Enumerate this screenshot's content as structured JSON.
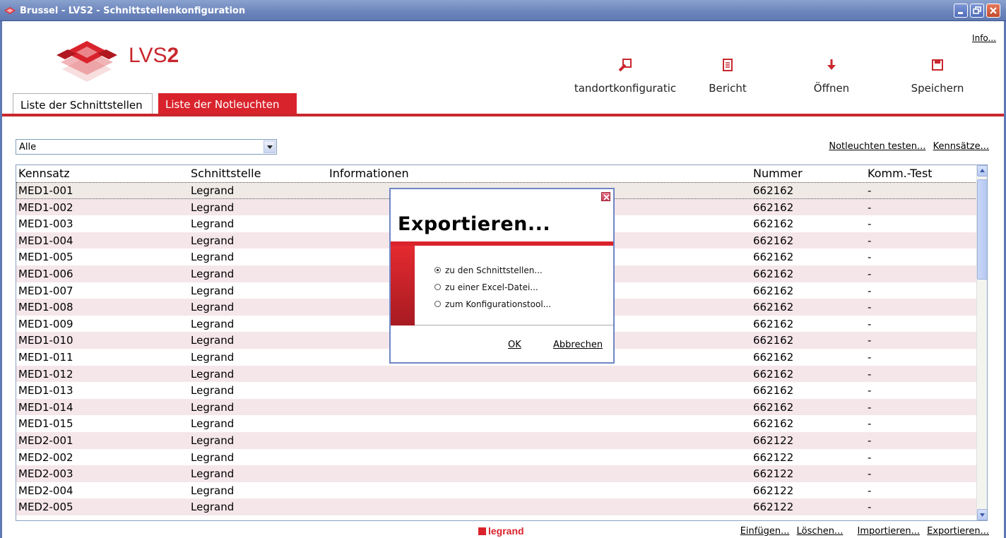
{
  "window": {
    "title": "Brussel   -   LVS2 - Schnittstellenkonfiguration"
  },
  "header": {
    "brand_prefix": "LVS",
    "brand_suffix": "2",
    "info_link": "Info...",
    "tabs": [
      {
        "label": "Liste der Schnittstellen",
        "active": true
      },
      {
        "label": "Liste der Notleuchten",
        "active": false
      }
    ],
    "toolbar": [
      {
        "label": "tandortkonfiguratic",
        "icon": "location-config-icon"
      },
      {
        "label": "Bericht",
        "icon": "report-icon"
      },
      {
        "label": "Öffnen",
        "icon": "open-arrow-icon"
      },
      {
        "label": "Speichern",
        "icon": "save-icon"
      }
    ]
  },
  "filter": {
    "selected": "Alle",
    "links": [
      "Notleuchten testen...",
      "Kennsätze..."
    ]
  },
  "table": {
    "columns": [
      "Kennsatz",
      "Schnittstelle",
      "Informationen",
      "Nummer",
      "Komm.-Test"
    ],
    "rows": [
      {
        "kennsatz": "MED1-001",
        "schnittstelle": "Legrand",
        "info": "",
        "nummer": "662162",
        "test": "-"
      },
      {
        "kennsatz": "MED1-002",
        "schnittstelle": "Legrand",
        "info": "",
        "nummer": "662162",
        "test": "-"
      },
      {
        "kennsatz": "MED1-003",
        "schnittstelle": "Legrand",
        "info": "",
        "nummer": "662162",
        "test": "-"
      },
      {
        "kennsatz": "MED1-004",
        "schnittstelle": "Legrand",
        "info": "",
        "nummer": "662162",
        "test": "-"
      },
      {
        "kennsatz": "MED1-005",
        "schnittstelle": "Legrand",
        "info": "",
        "nummer": "662162",
        "test": "-"
      },
      {
        "kennsatz": "MED1-006",
        "schnittstelle": "Legrand",
        "info": "",
        "nummer": "662162",
        "test": "-"
      },
      {
        "kennsatz": "MED1-007",
        "schnittstelle": "Legrand",
        "info": "",
        "nummer": "662162",
        "test": "-"
      },
      {
        "kennsatz": "MED1-008",
        "schnittstelle": "Legrand",
        "info": "",
        "nummer": "662162",
        "test": "-"
      },
      {
        "kennsatz": "MED1-009",
        "schnittstelle": "Legrand",
        "info": "",
        "nummer": "662162",
        "test": "-"
      },
      {
        "kennsatz": "MED1-010",
        "schnittstelle": "Legrand",
        "info": "",
        "nummer": "662162",
        "test": "-"
      },
      {
        "kennsatz": "MED1-011",
        "schnittstelle": "Legrand",
        "info": "",
        "nummer": "662162",
        "test": "-"
      },
      {
        "kennsatz": "MED1-012",
        "schnittstelle": "Legrand",
        "info": "",
        "nummer": "662162",
        "test": "-"
      },
      {
        "kennsatz": "MED1-013",
        "schnittstelle": "Legrand",
        "info": "",
        "nummer": "662162",
        "test": "-"
      },
      {
        "kennsatz": "MED1-014",
        "schnittstelle": "Legrand",
        "info": "",
        "nummer": "662162",
        "test": "-"
      },
      {
        "kennsatz": "MED1-015",
        "schnittstelle": "Legrand",
        "info": "",
        "nummer": "662162",
        "test": "-"
      },
      {
        "kennsatz": "MED2-001",
        "schnittstelle": "Legrand",
        "info": "",
        "nummer": "662122",
        "test": "-"
      },
      {
        "kennsatz": "MED2-002",
        "schnittstelle": "Legrand",
        "info": "",
        "nummer": "662122",
        "test": "-"
      },
      {
        "kennsatz": "MED2-003",
        "schnittstelle": "Legrand",
        "info": "",
        "nummer": "662122",
        "test": "-"
      },
      {
        "kennsatz": "MED2-004",
        "schnittstelle": "Legrand",
        "info": "",
        "nummer": "662122",
        "test": "-"
      },
      {
        "kennsatz": "MED2-005",
        "schnittstelle": "Legrand",
        "info": "",
        "nummer": "662122",
        "test": "-"
      }
    ]
  },
  "footer": {
    "logo_text": "legrand",
    "links": [
      "Einfügen...",
      "Löschen...",
      "Importieren...",
      "Exportieren..."
    ]
  },
  "dialog": {
    "title": "Exportieren...",
    "options": [
      {
        "label": "zu den Schnittstellen...",
        "checked": true
      },
      {
        "label": "zu einer Excel-Datei...",
        "checked": false
      },
      {
        "label": "zum Konfigurationstool...",
        "checked": false
      }
    ],
    "ok_label": "OK",
    "cancel_label": "Abbrechen"
  },
  "colors": {
    "accent": "#d9232c",
    "titlebar": "#6b84bb",
    "row_alt": "#f5e6ea"
  }
}
